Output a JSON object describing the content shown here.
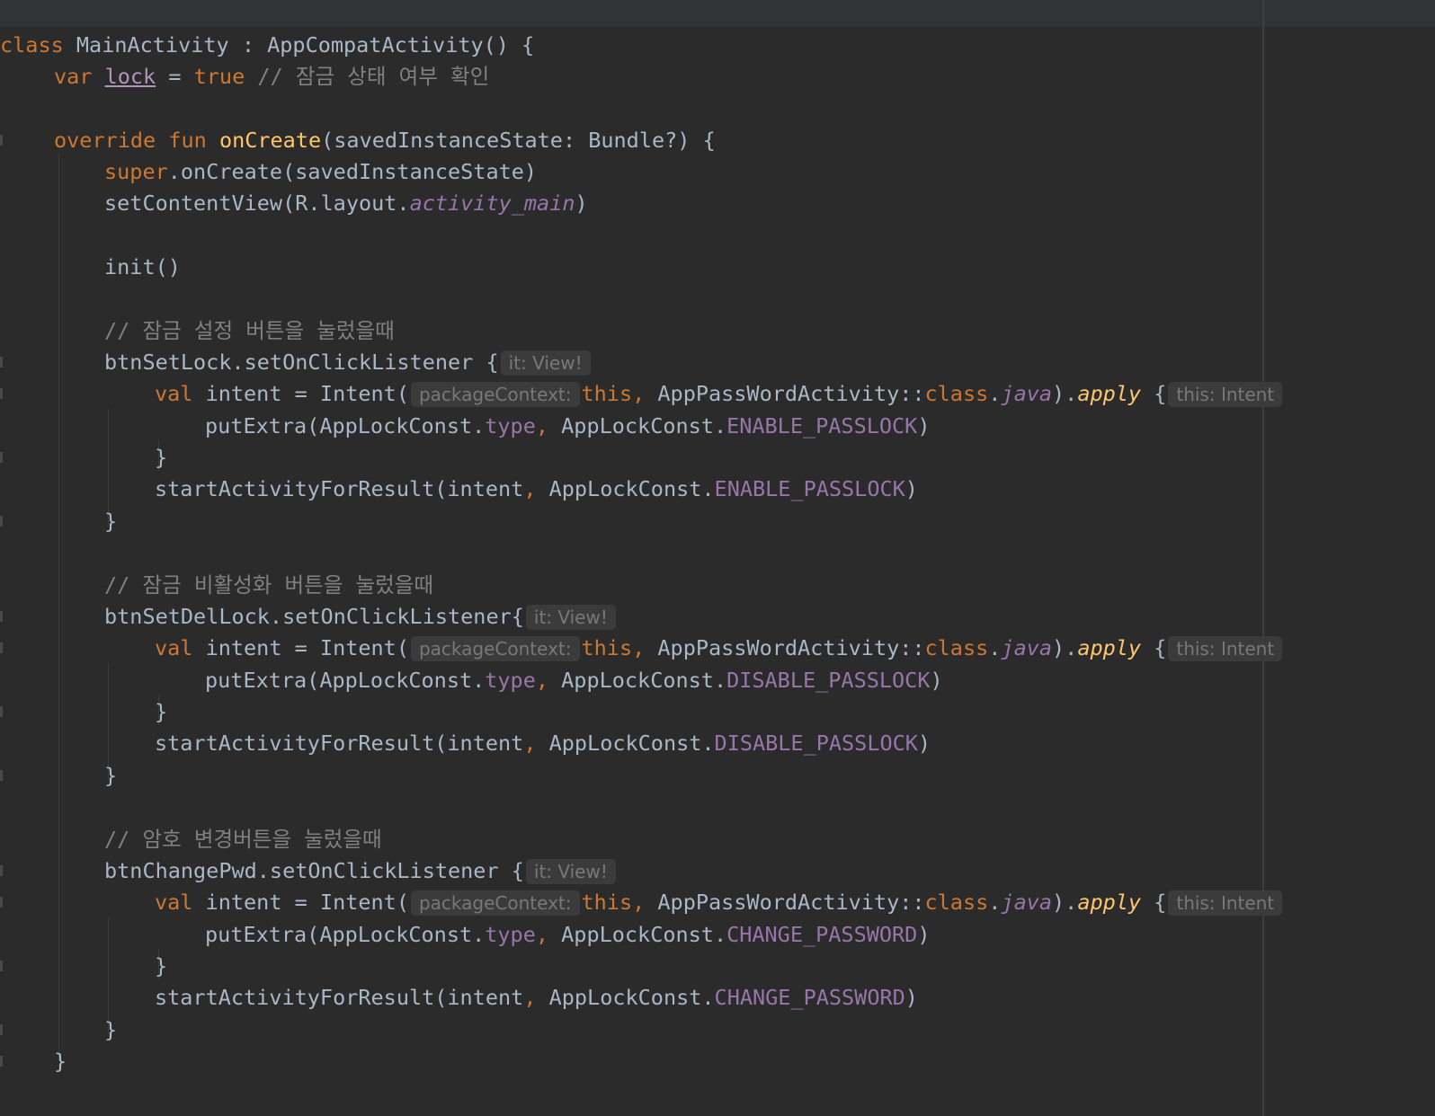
{
  "colors": {
    "background": "#2b2b2b",
    "keyword": "#cc7832",
    "function": "#ffc66d",
    "comment": "#808080",
    "property": "#9876aa",
    "text": "#a9b7c6",
    "hint_bg": "#3b3b3b",
    "hint_text": "#787878"
  },
  "code": {
    "l1": {
      "kw": "class",
      "rest": " MainActivity : AppCompatActivity() {"
    },
    "l2": {
      "kw1": "var ",
      "var": "lock",
      "mid": " = ",
      "kw2": "true",
      "cm": " // 잠금 상태 여부 확인"
    },
    "l3": {
      "kw1": "override ",
      "kw2": "fun ",
      "fn": "onCreate",
      "rest": "(savedInstanceState: Bundle?) {"
    },
    "l4": {
      "kw": "super",
      "rest": ".onCreate(savedInstanceState)"
    },
    "l5": {
      "pre": "setContentView(R.layout.",
      "stat": "activity_main",
      "post": ")"
    },
    "l6": {
      "text": "init()"
    },
    "blocks": [
      {
        "comment": "// 잠금 설정 버튼을 눌렀을때",
        "listener": "btnSetLock.setOnClickListener {",
        "hint_it": "it: View!",
        "val": "val ",
        "intent_pre": "intent = Intent(",
        "hint_ctx": "packageContext:",
        "this_kw": "this,",
        "activity": " AppPassWordActivity::",
        "class_kw": "class",
        "dot": ".",
        "java": "java",
        "close_paren": ").",
        "apply": "apply",
        "brace": " {",
        "hint_this": "this: Intent",
        "put_pre": "putExtra(AppLockConst.",
        "type": "type",
        "comma": ",",
        "put_mid": " AppLockConst.",
        "const": "ENABLE_PASSLOCK",
        "put_post": ")",
        "close_inner": "}",
        "start_pre": "startActivityForResult(intent",
        "start_comma": ",",
        "start_mid": " AppLockConst.",
        "start_const": "ENABLE_PASSLOCK",
        "start_post": ")",
        "close_outer": "}"
      },
      {
        "comment": "// 잠금 비활성화 버튼을 눌렀을때",
        "listener": "btnSetDelLock.setOnClickListener{",
        "hint_it": "it: View!",
        "val": "val ",
        "intent_pre": "intent = Intent(",
        "hint_ctx": "packageContext:",
        "this_kw": "this,",
        "activity": " AppPassWordActivity::",
        "class_kw": "class",
        "dot": ".",
        "java": "java",
        "close_paren": ").",
        "apply": "apply",
        "brace": " {",
        "hint_this": "this: Intent",
        "put_pre": "putExtra(AppLockConst.",
        "type": "type",
        "comma": ",",
        "put_mid": " AppLockConst.",
        "const": "DISABLE_PASSLOCK",
        "put_post": ")",
        "close_inner": "}",
        "start_pre": "startActivityForResult(intent",
        "start_comma": ",",
        "start_mid": " AppLockConst.",
        "start_const": "DISABLE_PASSLOCK",
        "start_post": ")",
        "close_outer": "}"
      },
      {
        "comment": "// 암호 변경버튼을 눌렀을때",
        "listener": "btnChangePwd.setOnClickListener {",
        "hint_it": "it: View!",
        "val": "val ",
        "intent_pre": "intent = Intent(",
        "hint_ctx": "packageContext:",
        "this_kw": "this,",
        "activity": " AppPassWordActivity::",
        "class_kw": "class",
        "dot": ".",
        "java": "java",
        "close_paren": ").",
        "apply": "apply",
        "brace": " {",
        "hint_this": "this: Intent",
        "put_pre": "putExtra(AppLockConst.",
        "type": "type",
        "comma": ",",
        "put_mid": " AppLockConst.",
        "const": "CHANGE_PASSWORD",
        "put_post": ")",
        "close_inner": "}",
        "start_pre": "startActivityForResult(intent",
        "start_comma": ",",
        "start_mid": " AppLockConst.",
        "start_const": "CHANGE_PASSWORD",
        "start_post": ")",
        "close_outer": "}"
      }
    ],
    "end_fun": "}"
  }
}
